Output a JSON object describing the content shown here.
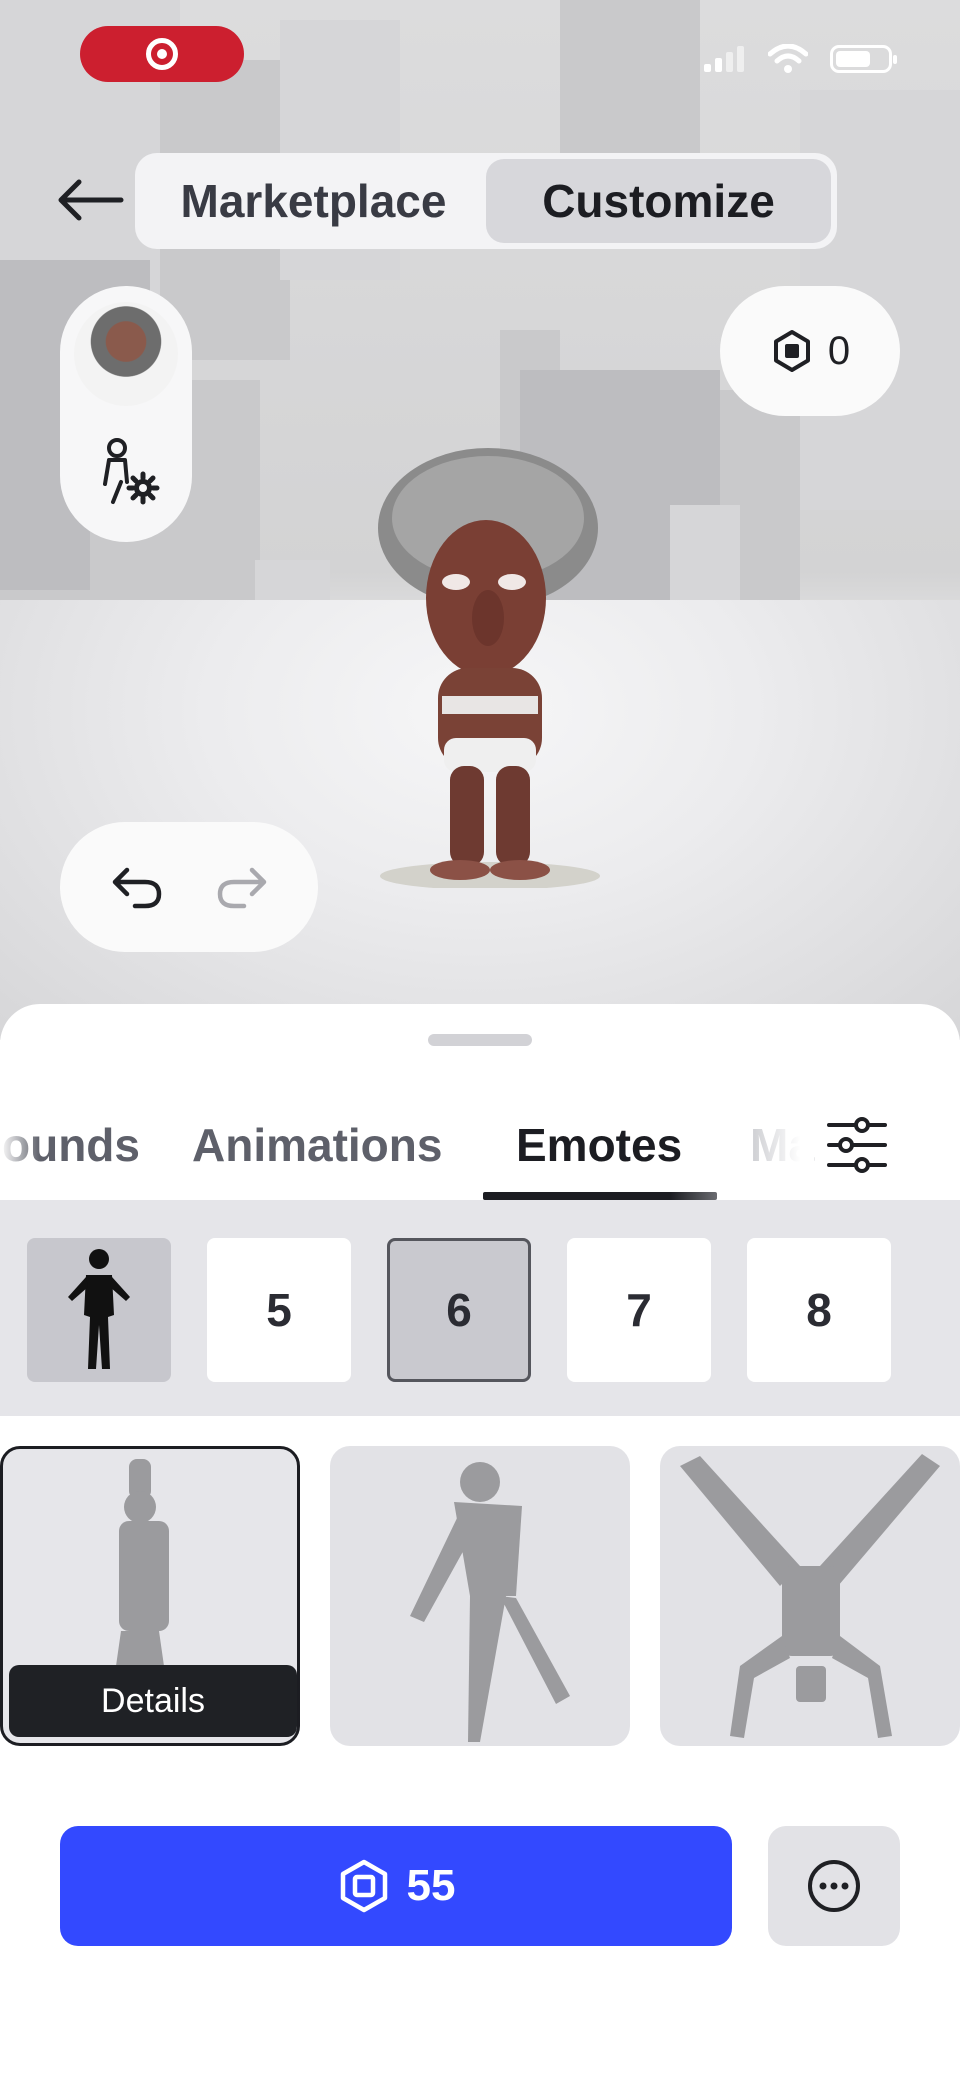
{
  "header": {
    "tabs": [
      {
        "label": "Marketplace",
        "active": false
      },
      {
        "label": "Customize",
        "active": true
      }
    ]
  },
  "robux_balance": "0",
  "categories": [
    {
      "label": "ounds"
    },
    {
      "label": "Animations"
    },
    {
      "label": "Emotes",
      "active": true
    },
    {
      "label": "Ma"
    }
  ],
  "emote_slots": [
    "5",
    "6",
    "7",
    "8"
  ],
  "selected_slot": "6",
  "tiles": {
    "details_label": "Details"
  },
  "purchase": {
    "price": "55"
  },
  "colors": {
    "accent": "#3349ff",
    "record": "#cc1f2f"
  },
  "icons": [
    "record-icon",
    "signal-icon",
    "wifi-icon",
    "battery-icon",
    "back-arrow-icon",
    "avatar-settings-icon",
    "robux-icon",
    "undo-icon",
    "redo-icon",
    "filter-icon",
    "more-icon"
  ]
}
